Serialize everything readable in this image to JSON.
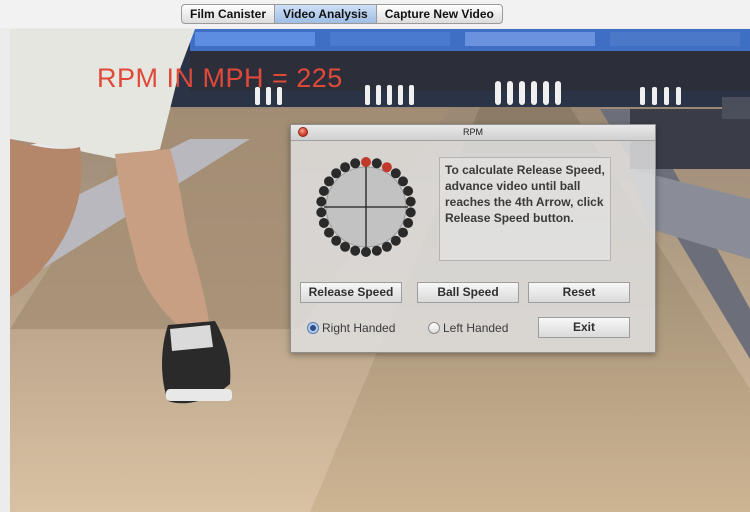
{
  "tabs": [
    {
      "label": "Film Canister",
      "active": false
    },
    {
      "label": "Video Analysis",
      "active": true
    },
    {
      "label": "Capture New Video",
      "active": false
    }
  ],
  "overlay": {
    "rpm_text": "RPM IN MPH = 225",
    "color": "#e0493a"
  },
  "dialog": {
    "title": "RPM",
    "instructions": "To calculate Release Speed, advance video until ball reaches the 4th Arrow, click Release Speed button.",
    "buttons": {
      "release_speed": "Release Speed",
      "ball_speed": "Ball Speed",
      "reset": "Reset",
      "exit": "Exit"
    },
    "handedness": {
      "right": "Right Handed",
      "left": "Left Handed",
      "selected": "right"
    }
  },
  "dial": {
    "marker_count": 26,
    "highlighted_markers": [
      0,
      2
    ],
    "highlight_color": "#c0392b",
    "marker_color": "#2a2a2a"
  },
  "icons": [
    "close-icon",
    "rpm-dial-icon",
    "radio-icon"
  ]
}
